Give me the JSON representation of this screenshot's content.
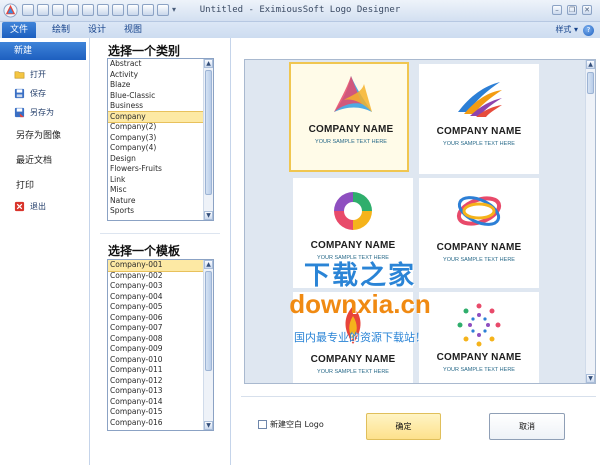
{
  "window": {
    "title": "Untitled - EximiousSoft Logo Designer",
    "minimize_glyph": "–",
    "restore_glyph": "❐",
    "close_glyph": "✕"
  },
  "ribbon": {
    "tabs": [
      "文件",
      "绘制",
      "设计",
      "视图"
    ],
    "active_tab": "文件",
    "style_menu": "样式 ▾",
    "help_glyph": "?"
  },
  "file_menu": {
    "new": "新建",
    "open": "打开",
    "save": "保存",
    "save_as": "另存为",
    "save_as_image": "另存为图像",
    "recent": "最近文档",
    "print": "打印",
    "exit": "退出"
  },
  "categories": {
    "title": "选择一个类别",
    "items": [
      "Abstract",
      "Activity",
      "Blaze",
      "Blue-Classic",
      "Business",
      "Company",
      "Company(2)",
      "Company(3)",
      "Company(4)",
      "Design",
      "Flowers-Fruits",
      "Link",
      "Misc",
      "Nature",
      "Sports"
    ],
    "selected": "Company"
  },
  "templates": {
    "title": "选择一个模板",
    "items": [
      "Company-001",
      "Company-002",
      "Company-003",
      "Company-004",
      "Company-005",
      "Company-006",
      "Company-007",
      "Company-008",
      "Company-009",
      "Company-010",
      "Company-011",
      "Company-012",
      "Company-013",
      "Company-014",
      "Company-015",
      "Company-016"
    ],
    "selected": "Company-001"
  },
  "gallery": {
    "cards": [
      {
        "name": "COMPANY NAME",
        "slogan": "YOUR SAMPLE TEXT HERE",
        "icon": "triangle-swirl-logo"
      },
      {
        "name": "COMPANY NAME",
        "slogan": "YOUR SAMPLE TEXT HERE",
        "icon": "wing-stripes-logo"
      },
      {
        "name": "COMPANY NAME",
        "slogan": "YOUR SAMPLE TEXT HERE",
        "icon": "ring-swirl-logo"
      },
      {
        "name": "COMPANY NAME",
        "slogan": "YOUR SAMPLE TEXT HERE",
        "icon": "orbit-logo"
      },
      {
        "name": "COMPANY NAME",
        "slogan": "YOUR SAMPLE TEXT HERE",
        "icon": "flame-logo"
      },
      {
        "name": "COMPANY NAME",
        "slogan": "YOUR SAMPLE TEXT HERE",
        "icon": "dot-spiral-logo"
      }
    ]
  },
  "watermark": {
    "line1": "下载之家",
    "line2": "downxia.cn",
    "line3": "国内最专业的资源下载站！"
  },
  "footer": {
    "blank_logo_label": "新建空白 Logo",
    "ok": "确定",
    "cancel": "取消"
  },
  "colors": {
    "accent": "#1d5fbf",
    "selection": "#fde9a4",
    "ok_button": "#fde18c"
  }
}
